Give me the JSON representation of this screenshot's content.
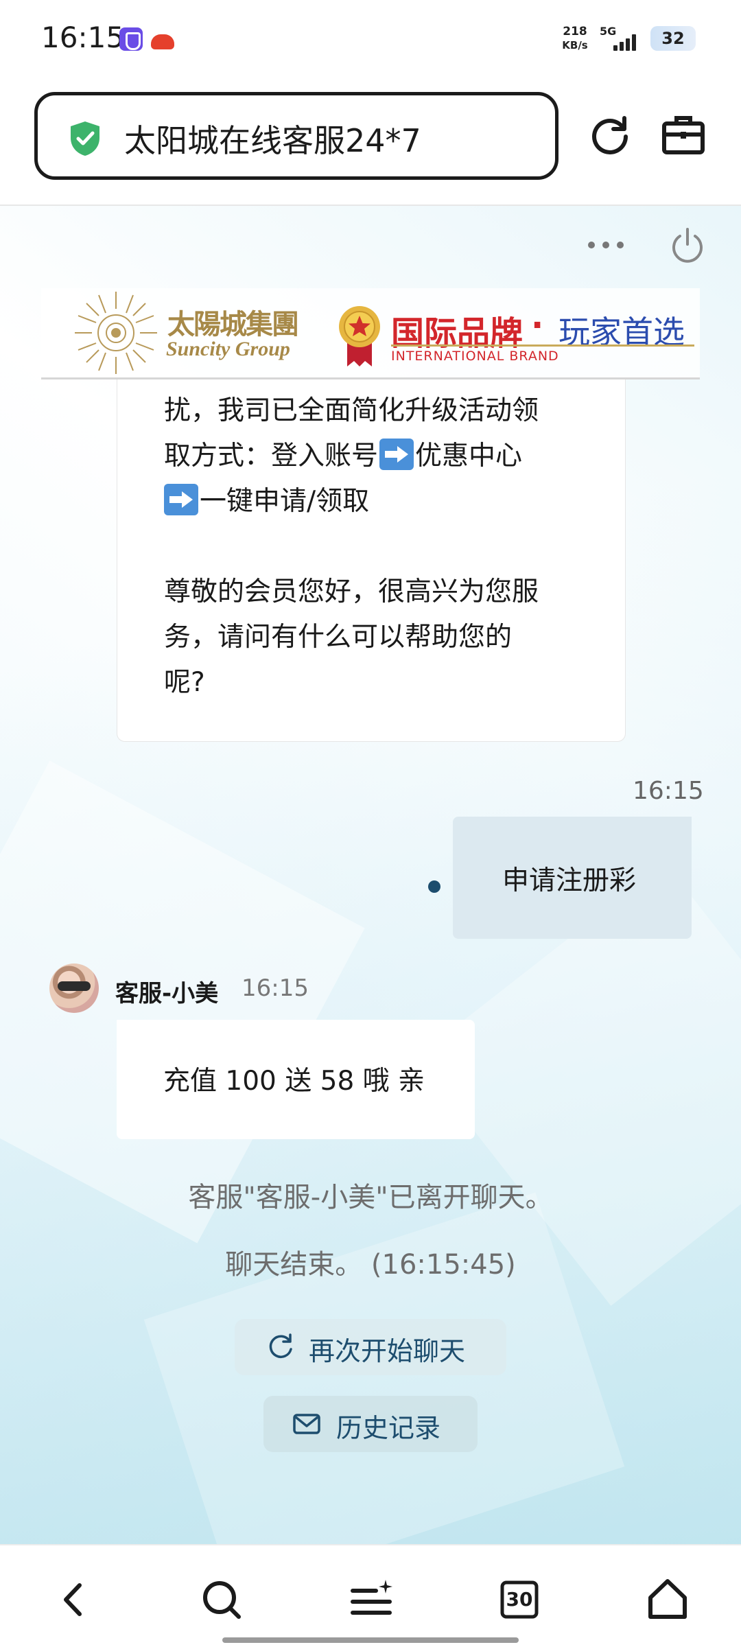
{
  "status_bar": {
    "time": "16:15",
    "net_speed_value": "218",
    "net_speed_unit": "KB/s",
    "network_type": "5G",
    "battery_level": "32",
    "app_icons": [
      "vpn-shield-icon",
      "cloud-app-icon"
    ]
  },
  "browser": {
    "page_title": "太阳城在线客服24*7",
    "secure_icon": "shield-check-icon",
    "reload_icon": "reload-icon",
    "tools_icon": "toolbox-icon"
  },
  "chat_header": {
    "more_icon": "more-dots-icon",
    "power_icon": "power-icon"
  },
  "banner": {
    "group_name_cn": "太陽城集團",
    "group_name_en": "Suncity Group",
    "brand_cn": "国际品牌",
    "brand_dot": "·",
    "brand_cn_2": "玩家首选",
    "brand_en": "INTERNATIONAL BRAND"
  },
  "messages": {
    "agent_msg_1": {
      "line_1": "扰，我司已全面简化升级活动领",
      "line_2_a": "取方式：登入账号",
      "line_2_b": "优惠中心",
      "line_3_b": "一键申请/领取",
      "line_4": "尊敬的会员您好，很高兴为您服",
      "line_5": "务，请问有什么可以帮助您的",
      "line_6": "呢?"
    },
    "user_msg": {
      "time": "16:15",
      "text": "申请注册彩"
    },
    "agent_msg_2": {
      "agent_name": "客服-小美",
      "time": "16:15",
      "text": "充值 100 送 58 哦 亲"
    },
    "system_left": "客服\"客服-小美\"已离开聊天。",
    "system_end": "聊天结束。 (16:15:45)"
  },
  "actions": {
    "restart_label": "再次开始聊天",
    "history_label": "历史记录"
  },
  "bottom_nav": {
    "back_icon": "back-arrow-icon",
    "search_icon": "search-icon",
    "menu_icon": "menu-sparkle-icon",
    "tabs_count": "30",
    "home_icon": "home-icon"
  },
  "colors": {
    "accent": "#1d4d6e",
    "shield_green": "#3db36b",
    "brand_red": "#d3262b",
    "brand_blue": "#2b4cae",
    "gold": "#a78948"
  }
}
